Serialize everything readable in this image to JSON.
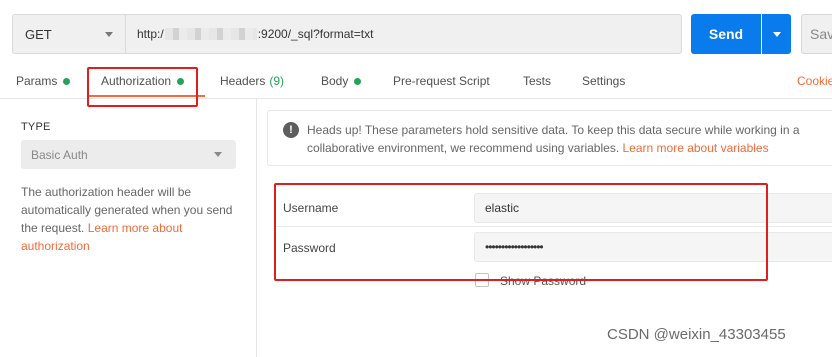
{
  "request": {
    "method": "GET",
    "url_prefix": "http:/",
    "url_suffix": ":9200/_sql?format=txt",
    "send_label": "Send",
    "save_label": "Sav"
  },
  "tabs": [
    {
      "label": "Params",
      "indicator": "dot"
    },
    {
      "label": "Authorization",
      "indicator": "dot",
      "active": true
    },
    {
      "label": "Headers",
      "count": "(9)"
    },
    {
      "label": "Body",
      "indicator": "dot"
    },
    {
      "label": "Pre-request Script"
    },
    {
      "label": "Tests"
    },
    {
      "label": "Settings"
    },
    {
      "label": "Cookie"
    }
  ],
  "auth": {
    "type_label": "TYPE",
    "type_value": "Basic Auth",
    "description": "The authorization header will be automatically generated when you send the request.",
    "description_link": "Learn more about authorization"
  },
  "notice": {
    "text": "Heads up! These parameters hold sensitive data. To keep this data secure while working in a collaborative environment, we recommend using variables.",
    "link": "Learn more about variables"
  },
  "fields": {
    "username_label": "Username",
    "username_value": "elastic",
    "password_label": "Password",
    "password_value": "••••••••••••••••••",
    "show_password_label": "Show Password"
  },
  "watermark": "CSDN @weixin_43303455",
  "colors": {
    "accent": "#f26b3a",
    "send_blue": "#097bed",
    "status_green": "#26a15b",
    "annotation_red": "#e01e1e"
  }
}
